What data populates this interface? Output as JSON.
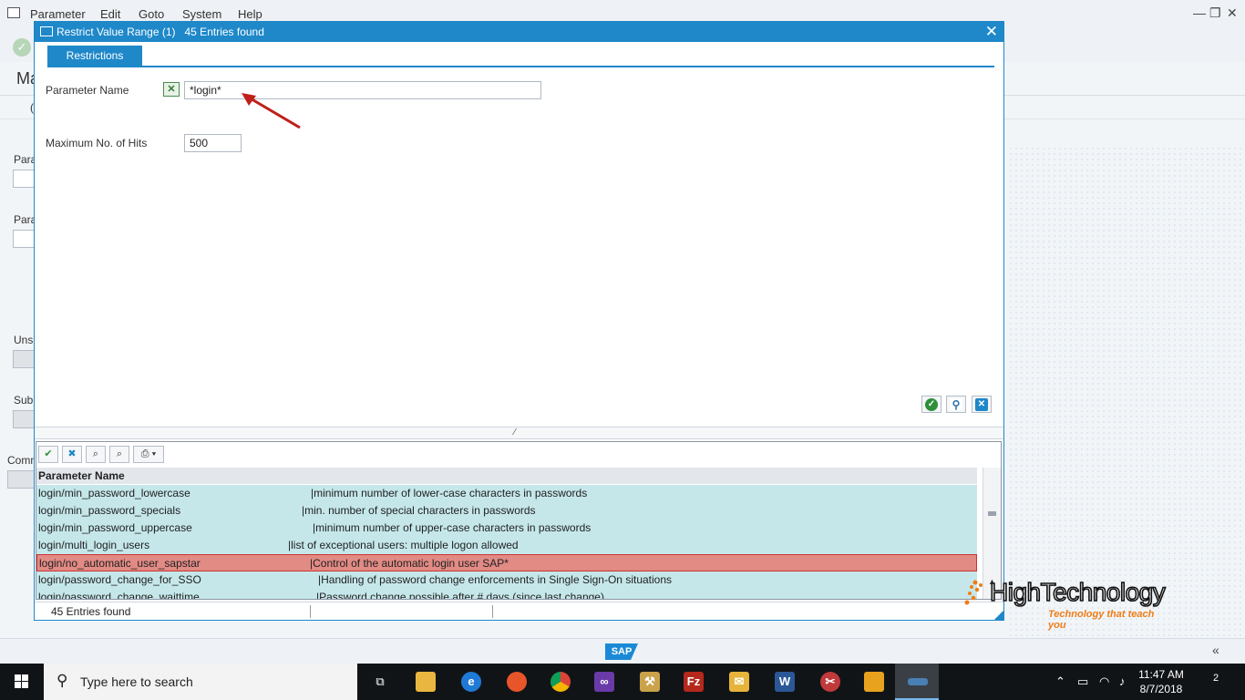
{
  "background_app": {
    "menu": [
      "Parameter",
      "Edit",
      "Goto",
      "System",
      "Help"
    ],
    "title_partial": "Ma",
    "labels": {
      "para1": "Para",
      "para2": "Para",
      "uns": "Uns",
      "sub": "Sub",
      "comm": "Comm",
      "tab_partial": "("
    },
    "logo": "SAP"
  },
  "dialog": {
    "title": "Restrict Value Range (1)   45 Entries found",
    "tab": "Restrictions",
    "parameter_name_label": "Parameter Name",
    "parameter_name_value": "*login*",
    "max_hits_label": "Maximum No. of Hits",
    "max_hits_value": "500",
    "results": {
      "header": "Parameter Name",
      "rows": [
        {
          "name": "login/min_password_lowercase",
          "desc": "|minimum number of lower-case characters in passwords",
          "selected": false
        },
        {
          "name": "login/min_password_specials",
          "desc": "|min. number of special characters in passwords",
          "selected": false
        },
        {
          "name": "login/min_password_uppercase",
          "desc": "|minimum number of upper-case characters in passwords",
          "selected": false
        },
        {
          "name": "login/multi_login_users",
          "desc": "|list of exceptional users: multiple logon allowed",
          "selected": false
        },
        {
          "name": "login/no_automatic_user_sapstar",
          "desc": "|Control of the automatic login user SAP*",
          "selected": true
        },
        {
          "name": "login/password_change_for_SSO",
          "desc": "|Handling of password change enforcements in Single Sign-On situations",
          "selected": false
        },
        {
          "name": "login/password_change_waittime",
          "desc": "|Password change possible after # days (since last change)",
          "selected": false
        }
      ]
    },
    "status": "45 Entries found"
  },
  "watermark": {
    "name": "HighTechnology",
    "tagline": "Technology that teach you"
  },
  "taskbar": {
    "search_placeholder": "Type here to search",
    "time": "11:47 AM",
    "date": "8/7/2018",
    "notification_count": "2"
  },
  "colors": {
    "accent": "#1e88c9",
    "row_bg": "#c5e7ea",
    "row_selected": "#e28a84",
    "arrow": "#c0201a"
  }
}
